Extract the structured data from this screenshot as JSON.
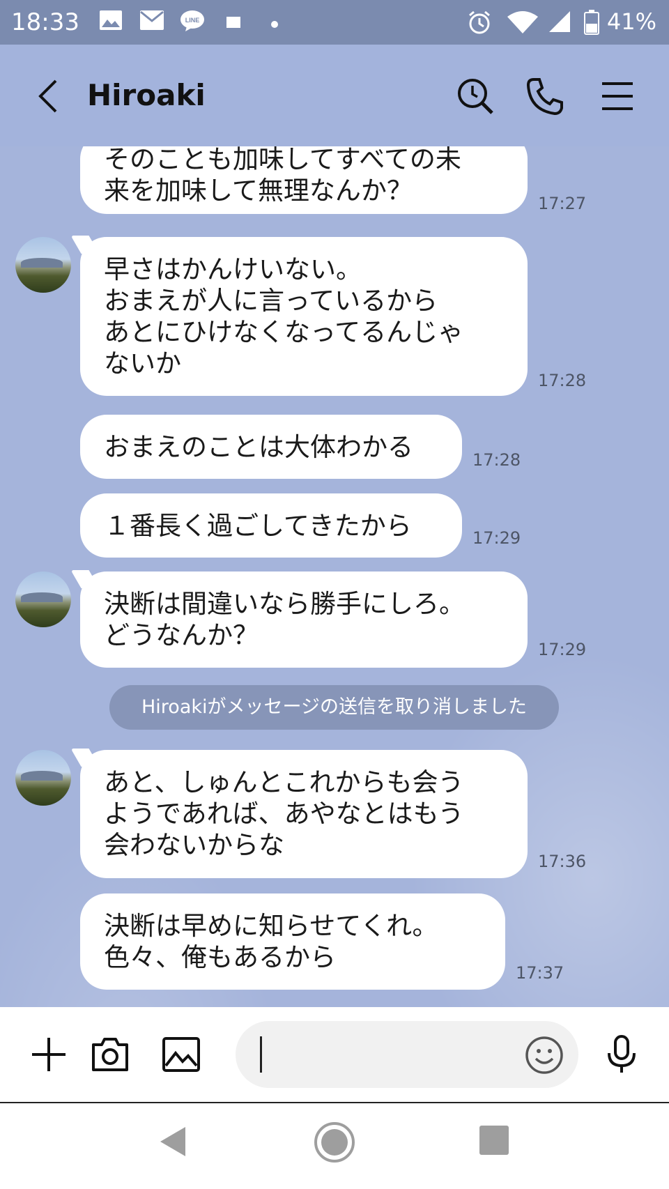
{
  "status_bar": {
    "time": "18:33",
    "battery_percent": "41%"
  },
  "header": {
    "contact_name": "Hiroaki"
  },
  "messages": [
    {
      "text": "そのことも加味してすべての未\n来を加味して無理なんか？",
      "time": "17:27"
    },
    {
      "text": "早さはかんけいない。\nおまえが人に言っているから\nあとにひけなくなってるんじゃ\nないか",
      "time": "17:28"
    },
    {
      "text": "おまえのことは大体わかる",
      "time": "17:28"
    },
    {
      "text": "１番長く過ごしてきたから",
      "time": "17:29"
    },
    {
      "text": "決断は間違いなら勝手にしろ。\nどうなんか？",
      "time": "17:29"
    },
    {
      "text": "あと、しゅんとこれからも会う\nようであれば、あやなとはもう\n会わないからな",
      "time": "17:36"
    },
    {
      "text": "決断は早めに知らせてくれ。\n色々、俺もあるから",
      "time": "17:37"
    }
  ],
  "system_message": "Hiroakiがメッセージの送信を取り消しました",
  "input": {
    "value": ""
  },
  "colors": {
    "chat_background": "#a5b4db",
    "status_bar": "#7b8baf",
    "bubble": "#ffffff",
    "system_pill": "#8795b8"
  }
}
